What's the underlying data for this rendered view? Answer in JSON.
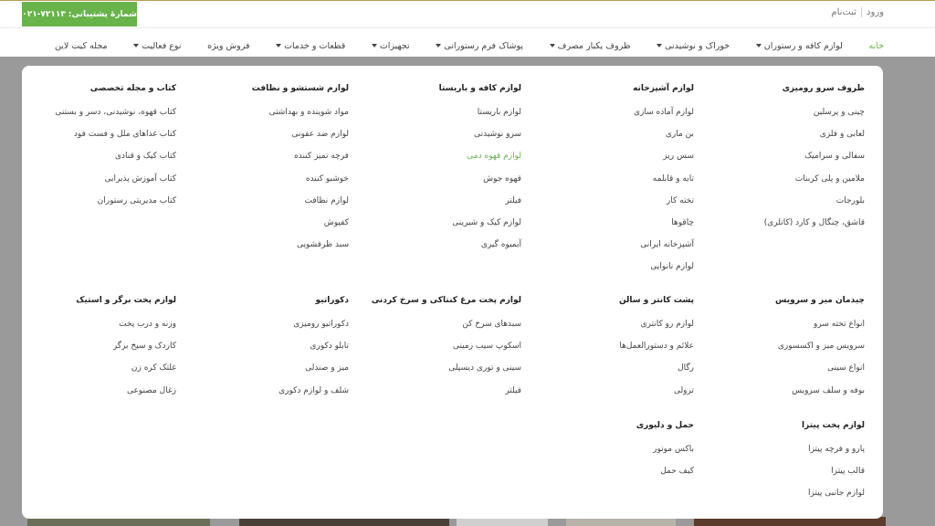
{
  "topbar": {
    "support_label": "شمارهٔ پشتیبانی:",
    "support_phone": "۰۲۱-۷۲۱۱۳",
    "login": "ورود",
    "register": "ثبت‌نام"
  },
  "nav": [
    {
      "label": "خانه",
      "active": true,
      "dropdown": false
    },
    {
      "label": "لوازم کافه و رستوران",
      "dropdown": true
    },
    {
      "label": "خوراک و نوشیدنی",
      "dropdown": true
    },
    {
      "label": "ظروف یکبار مصرف",
      "dropdown": true
    },
    {
      "label": "پوشاک فرم رستورانی",
      "dropdown": true
    },
    {
      "label": "تجهیزات",
      "dropdown": true
    },
    {
      "label": "قطعات و خدمات",
      "dropdown": true
    },
    {
      "label": "فروش ویژه",
      "dropdown": false
    },
    {
      "label": "نوع فعالیت",
      "dropdown": true
    },
    {
      "label": "مجله کیت لاین",
      "dropdown": false
    }
  ],
  "menu": {
    "c1": {
      "title": "ظروف سرو رومیزی",
      "items": [
        "چینی و پرسلین",
        "لعابی و فلزی",
        "سفالی و سرامیک",
        "ملامین و پلی کربنات",
        "بلورجات",
        "قاشق، چنگال و کارد (کاتلری)"
      ]
    },
    "c2": {
      "title": "لوازم آشپزخانه",
      "items": [
        "لوازم آماده سازی",
        "بن ماری",
        "سس ریز",
        "تابه و قابلمه",
        "تخته کار",
        "چاقوها",
        "آشپزخانه ایرانی",
        "لوازم نانوایی"
      ]
    },
    "c3": {
      "title": "لوازم کافه و باریستا",
      "items": [
        "لوازم باریستا",
        "سرو نوشیدنی",
        "لوازم قهوه دمی",
        "قهوه جوش",
        "فیلتر",
        "لوازم کیک و شیرینی",
        "آبمیوه گیری"
      ]
    },
    "c4": {
      "title": "لوازم شستشو و نظافت",
      "items": [
        "مواد شوینده و بهداشتی",
        "لوازم ضد عفونی",
        "فرچه تمیز کننده",
        "خوشبو کننده",
        "لوازم نظافت",
        "کفپوش",
        "سبد ظرفشویی"
      ]
    },
    "c5": {
      "title": "کتاب و مجله تخصصی",
      "items": [
        "کتاب قهوه، نوشیدنی، دسر و بستنی",
        "کتاب غذاهای ملل و فست فود",
        "کتاب کیک و قنادی",
        "کتاب آموزش پذیرایی",
        "کتاب مدیریتی رستوران"
      ]
    },
    "c6": {
      "title": "چیدمان میز و سرویس",
      "items": [
        "انواع تخته سرو",
        "سرویس میز و اکسسوری",
        "انواع سینی",
        "بوفه و سلف سرویس"
      ]
    },
    "c7": {
      "title": "پشت کانتر و سالن",
      "items": [
        "لوازم رو کانتری",
        "علائم و دستورالعمل‌ها",
        "رگال",
        "ترولی"
      ]
    },
    "c8": {
      "title": "لوازم پخت مرغ کنتاکی و سرخ کردنی",
      "items": [
        "سبدهای سرخ کن",
        "اسکوپ سیب زمینی",
        "سینی و توری دیسپلی",
        "فیلتر"
      ]
    },
    "c9": {
      "title": "دکوراتیو",
      "items": [
        "دکوراتیو رومیزی",
        "تابلو دکوری",
        "میز و صندلی",
        "شلف و لوازم دکوری"
      ]
    },
    "c10": {
      "title": "لوازم پخت برگر و استیک",
      "items": [
        "وزنه و درب پخت",
        "کاردک و سیخ برگر",
        "غلتک کره زن",
        "زغال مصنوعی"
      ]
    },
    "c11": {
      "title": "لوازم پخت پیتزا",
      "items": [
        "پارو و فرچه پیتزا",
        "قالب پیتزا",
        "لوازم جانبی پیتزا"
      ]
    },
    "c12": {
      "title": "حمل و دلیوری",
      "items": [
        "باکس موتور",
        "کیف حمل"
      ]
    }
  },
  "highlight_item": "لوازم قهوه دمی",
  "colors": {
    "accent": "#68b34a",
    "topline": "#b99c5b",
    "overlay": "#9a9a9a"
  }
}
